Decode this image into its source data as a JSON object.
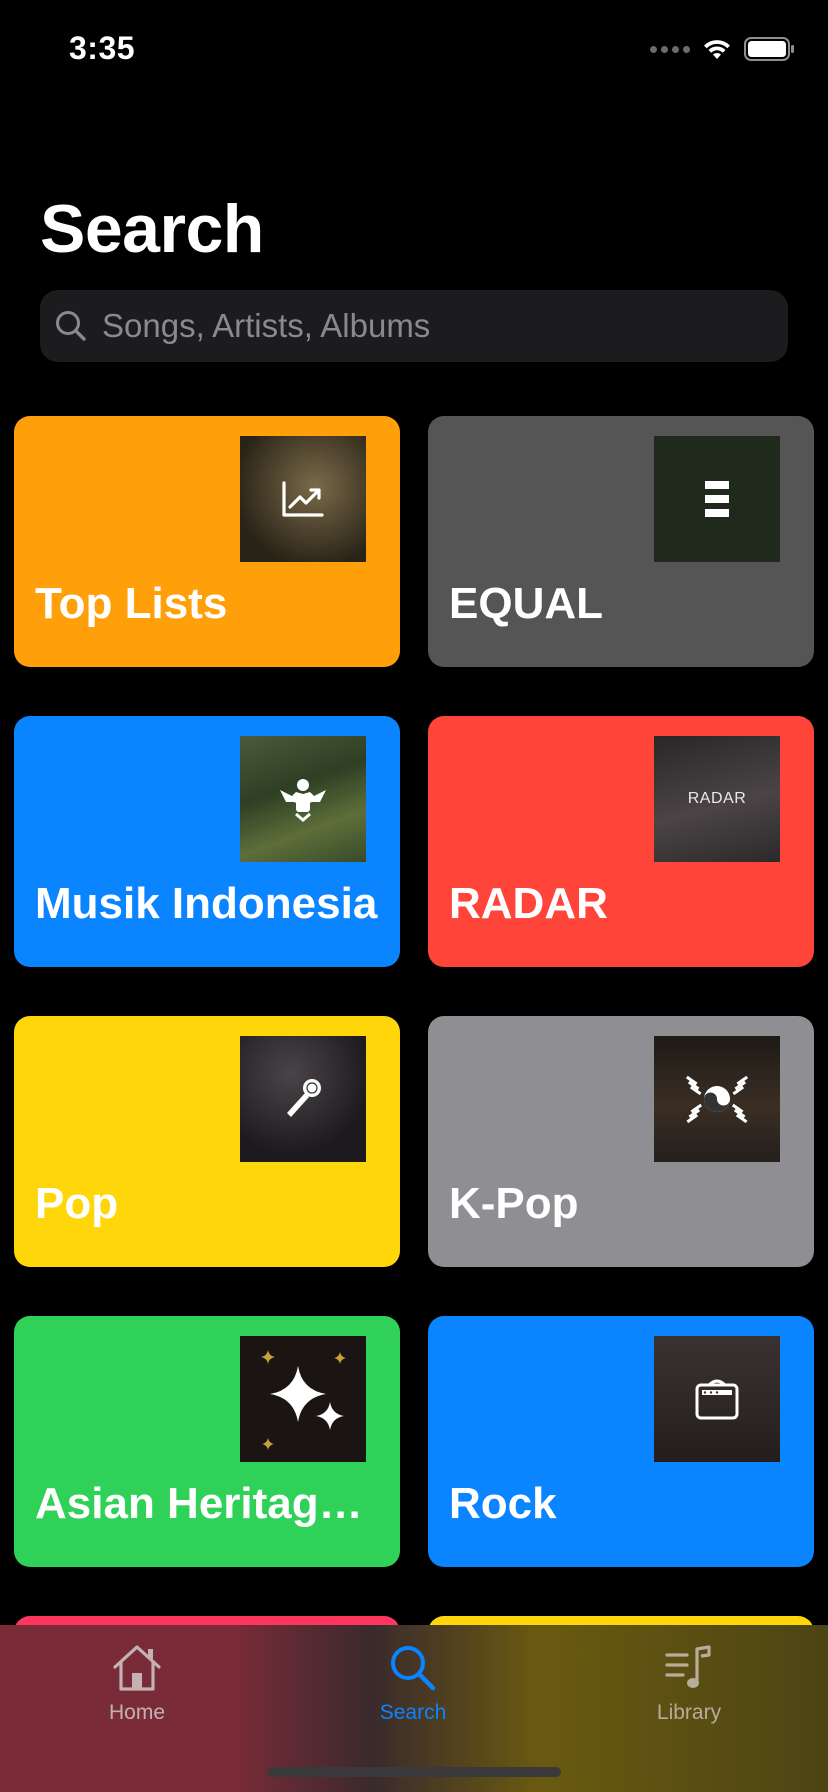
{
  "status_bar": {
    "time": "3:35"
  },
  "page": {
    "title": "Search"
  },
  "search": {
    "placeholder": "Songs, Artists, Albums"
  },
  "categories": [
    {
      "label": "Top Lists",
      "color": "#ff9f0a",
      "icon": "chart-trend-icon"
    },
    {
      "label": "EQUAL",
      "color": "#555555",
      "icon": "equal-bars-icon"
    },
    {
      "label": "Musik Indonesia",
      "color": "#0a84ff",
      "icon": "garuda-emblem-icon"
    },
    {
      "label": "RADAR",
      "color": "#ff453a",
      "icon": "radar-text-art",
      "art_text": "RADAR"
    },
    {
      "label": "Pop",
      "color": "#ffd60a",
      "icon": "microphone-icon"
    },
    {
      "label": "K-Pop",
      "color": "#8e8e93",
      "icon": "taegeuk-icon"
    },
    {
      "label": "Asian Heritage…",
      "color": "#30d158",
      "icon": "sparkles-icon"
    },
    {
      "label": "Rock",
      "color": "#0a84ff",
      "icon": "amplifier-icon"
    }
  ],
  "partial_cards": [
    {
      "color": "#ff375f"
    },
    {
      "color": "#ffd60a"
    }
  ],
  "tab_bar": {
    "tabs": [
      {
        "label": "Home",
        "icon": "home-icon",
        "active": false
      },
      {
        "label": "Search",
        "icon": "search-icon",
        "active": true
      },
      {
        "label": "Library",
        "icon": "library-icon",
        "active": false
      }
    ],
    "active_color": "#0a84ff",
    "inactive_color": "#b0a0a0"
  }
}
